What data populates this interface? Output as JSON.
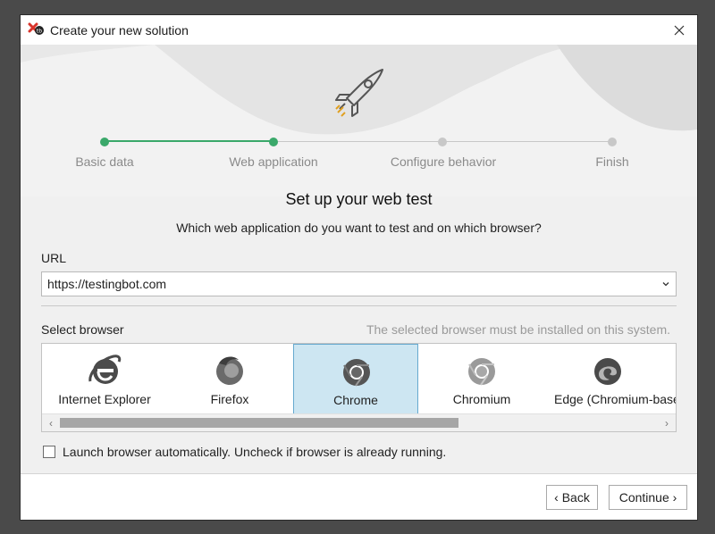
{
  "window": {
    "title": "Create your new solution"
  },
  "steps": [
    {
      "label": "Basic data",
      "state": "done"
    },
    {
      "label": "Web application",
      "state": "current"
    },
    {
      "label": "Configure behavior",
      "state": "pending"
    },
    {
      "label": "Finish",
      "state": "pending"
    }
  ],
  "main": {
    "heading": "Set up your web test",
    "subheading": "Which web application do you want to test and on which browser?"
  },
  "url": {
    "label": "URL",
    "value": "https://testingbot.com"
  },
  "browser": {
    "label": "Select browser",
    "note": "The selected browser must be installed on this system.",
    "selected": "Chrome",
    "items": [
      {
        "name": "Internet Explorer",
        "icon": "internet-explorer-icon"
      },
      {
        "name": "Firefox",
        "icon": "firefox-icon"
      },
      {
        "name": "Chrome",
        "icon": "chrome-icon"
      },
      {
        "name": "Chromium",
        "icon": "chromium-icon"
      },
      {
        "name": "Edge (Chromium-based)",
        "icon": "edge-icon"
      }
    ]
  },
  "launch": {
    "checked": false,
    "label": "Launch browser automatically. Uncheck if browser is already running."
  },
  "footer": {
    "back_label": "‹ Back",
    "continue_label": "Continue ›"
  },
  "colors": {
    "accent_green": "#3aa86a",
    "selection_bg": "#cde6f2",
    "selection_border": "#66a9cf",
    "pending_gray": "#c8c8c8"
  }
}
